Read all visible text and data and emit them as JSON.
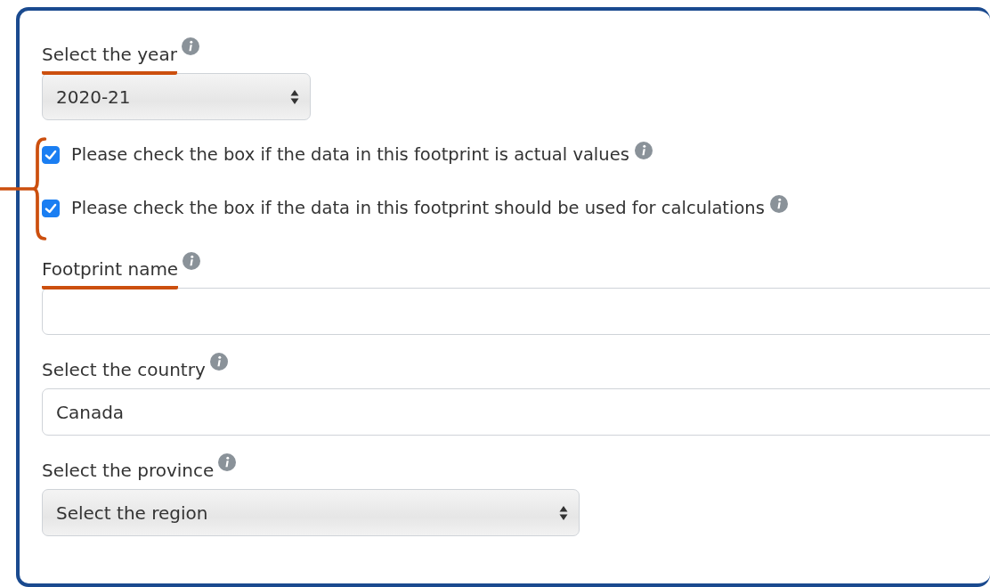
{
  "sections": [
    {
      "kind": "dropdown",
      "label": "Select the year",
      "highlighted": true,
      "value": "2020-21"
    },
    {
      "kind": "checkboxes",
      "bracketed": true,
      "items": [
        {
          "label": "Please check the box if the data in this footprint is actual values",
          "checked": true
        },
        {
          "label": "Please check the box if the data in this footprint should be used for calculations",
          "checked": true
        }
      ]
    },
    {
      "kind": "text",
      "label": "Footprint name",
      "highlighted": true
    },
    {
      "kind": "picker",
      "label": "Select the country",
      "highlighted": false,
      "value": "Canada"
    },
    {
      "kind": "dropdown",
      "label": "Select the province",
      "highlighted": false,
      "value": "Select the region"
    }
  ]
}
